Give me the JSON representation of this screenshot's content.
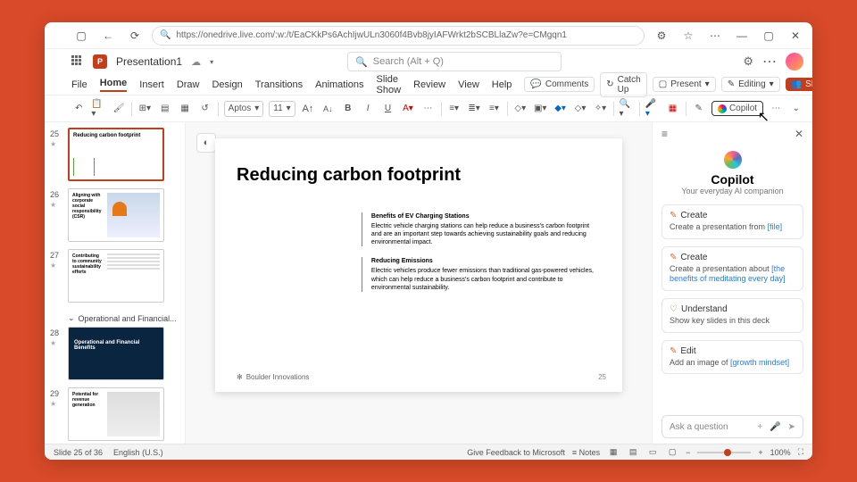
{
  "browser": {
    "url": "https://onedrive.live.com/:w:/t/EaCKkPs6AchIjwULn3060f4Bvb8jyIAFWrkt2bSCBLlaZw?e=CMgqn1"
  },
  "doc": {
    "name": "Presentation1"
  },
  "search": {
    "placeholder": "Search (Alt + Q)"
  },
  "tabs": {
    "items": [
      "File",
      "Home",
      "Insert",
      "Draw",
      "Design",
      "Transitions",
      "Animations",
      "Slide Show",
      "Review",
      "View",
      "Help"
    ],
    "active": 1,
    "comments": "Comments",
    "catchup": "Catch Up",
    "present": "Present",
    "editing": "Editing",
    "share": "Share"
  },
  "ribbon": {
    "font_name": "Aptos",
    "font_size": "11",
    "copilot": "Copilot"
  },
  "thumbs": {
    "section": "Operational and Financial...",
    "items": [
      {
        "n": "25",
        "title": "Reducing carbon footprint"
      },
      {
        "n": "26",
        "title": "Aligning with corporate social responsibility (CSR)"
      },
      {
        "n": "27",
        "title": "Contributing to community sustainability efforts"
      },
      {
        "n": "28",
        "title": "Operational and Financial Benefits"
      },
      {
        "n": "29",
        "title": "Potential for revenue generation"
      }
    ]
  },
  "slide": {
    "title": "Reducing carbon footprint",
    "b1t": "Benefits of EV Charging Stations",
    "b1b": "Electric vehicle charging stations can help reduce a business's carbon footprint and are an important step towards achieving sustainability goals and reducing environmental impact.",
    "b2t": "Reducing Emissions",
    "b2b": "Electric vehicles produce fewer emissions than traditional gas-powered vehicles, which can help reduce a business's carbon footprint and contribute to environmental sustainability.",
    "footer": "Boulder Innovations",
    "page": "25"
  },
  "copilot": {
    "title": "Copilot",
    "sub": "Your everyday AI companion",
    "cards": [
      {
        "icon": "✎",
        "title": "Create",
        "body": "Create a presentation from ",
        "ph": "[file]"
      },
      {
        "icon": "✎",
        "title": "Create",
        "body": "Create a presentation about ",
        "ph": "[the benefits of meditating every day]"
      },
      {
        "icon": "♡",
        "title": "Understand",
        "body": "Show key slides in this deck",
        "ph": ""
      },
      {
        "icon": "✎",
        "title": "Edit",
        "body": "Add an image of ",
        "ph": "[growth mindset]"
      }
    ],
    "ask": "Ask a question"
  },
  "status": {
    "slide": "Slide 25 of 36",
    "lang": "English (U.S.)",
    "feedback": "Give Feedback to Microsoft",
    "notes": "Notes",
    "zoom": "100%"
  }
}
